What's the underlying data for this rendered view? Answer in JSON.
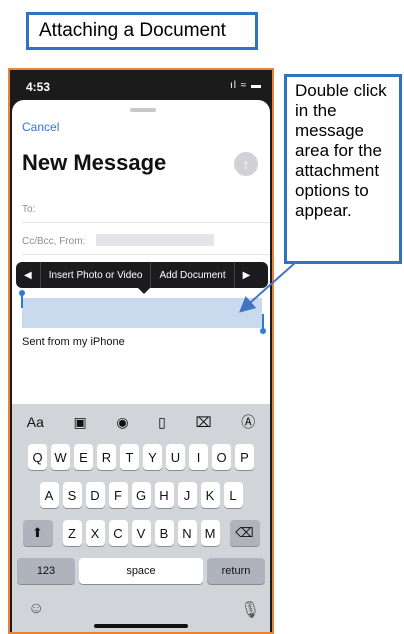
{
  "title": "Attaching a Document",
  "status": {
    "time": "4:53",
    "right": "ıl ≈ ▬"
  },
  "compose": {
    "cancel": "Cancel",
    "heading": "New Message",
    "send_icon": "arrow-up",
    "to_label": "To:",
    "ccbcc_label": "Cc/Bcc, From:",
    "signature": "Sent from my iPhone"
  },
  "popup": {
    "left_arrow": "◀",
    "items": [
      "Insert Photo or Video",
      "Add Document"
    ],
    "right_arrow": "▶"
  },
  "keyboard": {
    "toolbar": [
      "Aa",
      "▣",
      "◉",
      "▯",
      "⌧",
      "Ⓐ"
    ],
    "row1": [
      "Q",
      "W",
      "E",
      "R",
      "T",
      "Y",
      "U",
      "I",
      "O",
      "P"
    ],
    "row2": [
      "A",
      "S",
      "D",
      "F",
      "G",
      "H",
      "J",
      "K",
      "L"
    ],
    "row3": [
      "Z",
      "X",
      "C",
      "V",
      "B",
      "N",
      "M"
    ],
    "shift": "⬆",
    "backspace": "⌫",
    "numbers": "123",
    "space": "space",
    "return": "return",
    "emoji": "☺",
    "mic": "🎙"
  },
  "callout": "Double click in the message area for the attachment options to appear.",
  "colors": {
    "callout_border": "#2f74c0",
    "phone_border": "#e8833a",
    "accent": "#2e7bd6"
  }
}
